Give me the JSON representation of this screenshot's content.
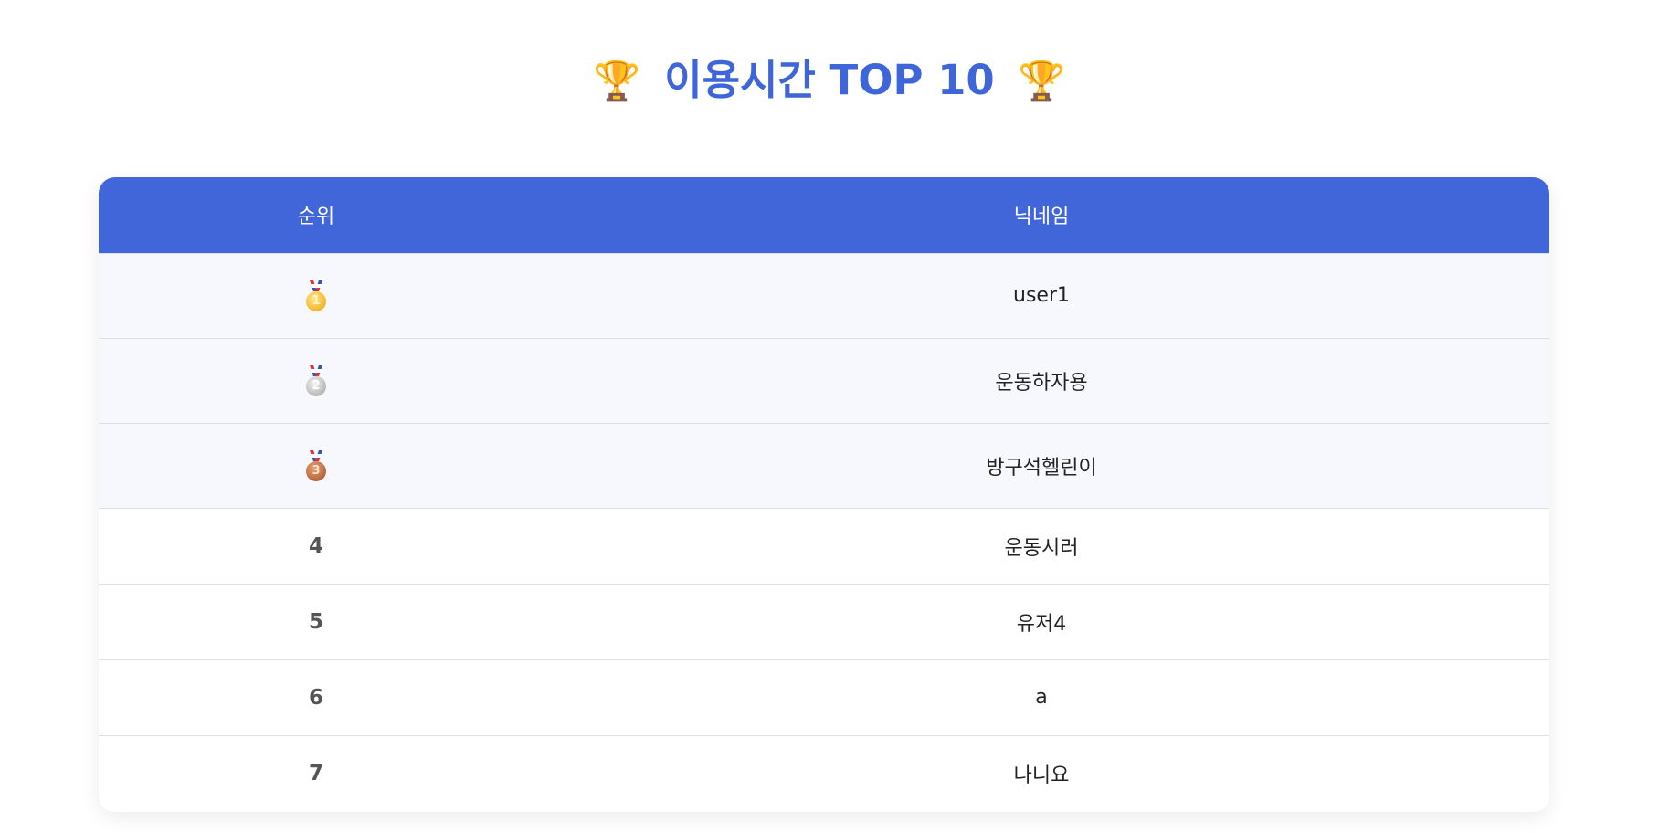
{
  "header": {
    "trophy_left": "🏆",
    "title": "이용시간 TOP 10",
    "trophy_right": "🏆"
  },
  "table": {
    "columns": [
      "순위",
      "닉네임"
    ],
    "rows": [
      {
        "rank": "1",
        "medal": "gold-medal-icon",
        "nickname": "user1"
      },
      {
        "rank": "2",
        "medal": "silver-medal-icon",
        "nickname": "운동하자용"
      },
      {
        "rank": "3",
        "medal": "bronze-medal-icon",
        "nickname": "방구석헬린이"
      },
      {
        "rank": "4",
        "nickname": "운동시러"
      },
      {
        "rank": "5",
        "nickname": "유저4"
      },
      {
        "rank": "6",
        "nickname": "a"
      },
      {
        "rank": "7",
        "nickname": "나니요"
      }
    ]
  },
  "colors": {
    "accent": "#4166d9",
    "title": "#3e66d8",
    "top3_row_bg": "#f6f8fd"
  }
}
